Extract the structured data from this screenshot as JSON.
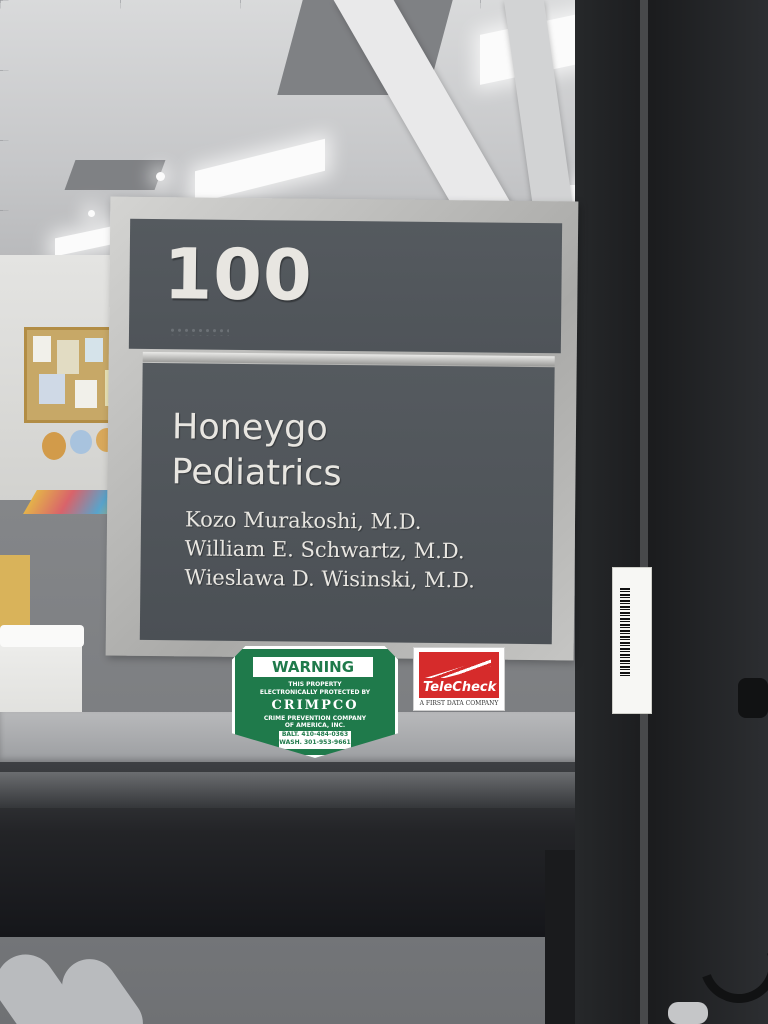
{
  "sign": {
    "room_number": "100",
    "practice_line1": "Honeygo",
    "practice_line2": "Pediatrics",
    "doctors": [
      "Kozo Murakoshi, M.D.",
      "William E. Schwartz, M.D.",
      "Wieslawa D. Wisinski, M.D."
    ]
  },
  "warning_sticker": {
    "title": "WARNING",
    "line1": "THIS PROPERTY",
    "line2": "ELECTRONICALLY PROTECTED BY",
    "brand": "CRIMPCO",
    "line3": "CRIME PREVENTION COMPANY",
    "line4": "OF AMERICA, INC.",
    "phone1": "BALT. 410-484-0363",
    "phone2": "WASH. 301-953-9661"
  },
  "telecheck_sticker": {
    "name": "TeleCheck",
    "tagline": "A FIRST DATA COMPANY"
  },
  "colors": {
    "sign_panel": "#52575c",
    "sign_text": "#e8e6e1",
    "warning_green": "#1f7a4b",
    "telecheck_red": "#d62b2b",
    "door_frame": "#1b1c1e"
  }
}
